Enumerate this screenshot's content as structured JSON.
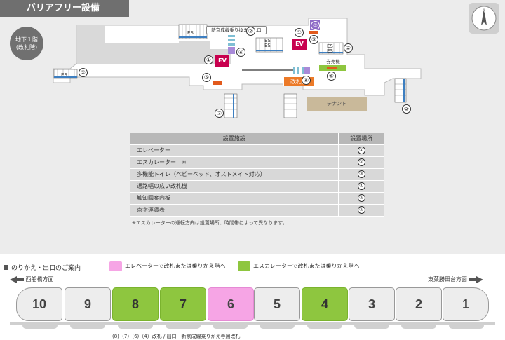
{
  "header": {
    "title": "バリアフリー設備"
  },
  "floor_badge": {
    "line1": "地下１階",
    "line2": "(改札階)"
  },
  "map": {
    "callout": "新京成線乗り換え改札口",
    "ticket_machine": "券売機",
    "gate": "改札口",
    "tenant": "テナント",
    "ev_label": "EV",
    "es_label": "ES",
    "markers": [
      "①",
      "②",
      "③",
      "④",
      "⑤",
      "⑥"
    ],
    "colors": {
      "ev": "#c8004e",
      "gate": "#ec7a28",
      "accessible_toilet": "#8e6bc6",
      "tactile": "#e25a1c",
      "ticket_green": "#8ec63f"
    }
  },
  "facility_table": {
    "headers": {
      "name": "設置施設",
      "location": "設置場所"
    },
    "rows": [
      {
        "name": "エレベーター",
        "location": "①"
      },
      {
        "name": "エスカレーター　※",
        "location": "②"
      },
      {
        "name": "多機能トイレ（ベビーベッド、オストメイト対応）",
        "location": "③"
      },
      {
        "name": "通路幅の広い改札機",
        "location": "④"
      },
      {
        "name": "触知図案内板",
        "location": "⑤"
      },
      {
        "name": "点字運賃表",
        "location": "⑥"
      }
    ],
    "note": "※エスカレーターの運転方向は設置場所、時間帯によって異なります。"
  },
  "transfer": {
    "title": "のりかえ・出口のご案内",
    "legend_elevator": "エレベーターで改札または乗りかえ階へ",
    "legend_escalator": "エスカレーターで改札または乗りかえ階へ",
    "legend_colors": {
      "elevator": "#f6a5e5",
      "escalator": "#8ec63f"
    },
    "dir_left": "西船橋方面",
    "dir_right": "東葉勝田台方面",
    "cars": [
      {
        "number": "10",
        "type": "none"
      },
      {
        "number": "9",
        "type": "none"
      },
      {
        "number": "8",
        "type": "escalator"
      },
      {
        "number": "7",
        "type": "escalator"
      },
      {
        "number": "6",
        "type": "elevator"
      },
      {
        "number": "5",
        "type": "none"
      },
      {
        "number": "4",
        "type": "escalator"
      },
      {
        "number": "3",
        "type": "none"
      },
      {
        "number": "2",
        "type": "none"
      },
      {
        "number": "1",
        "type": "none"
      }
    ],
    "footnote": "(8)（7）(6)（4）改札 / 出口　新京成線乗りかえ専用改札"
  }
}
